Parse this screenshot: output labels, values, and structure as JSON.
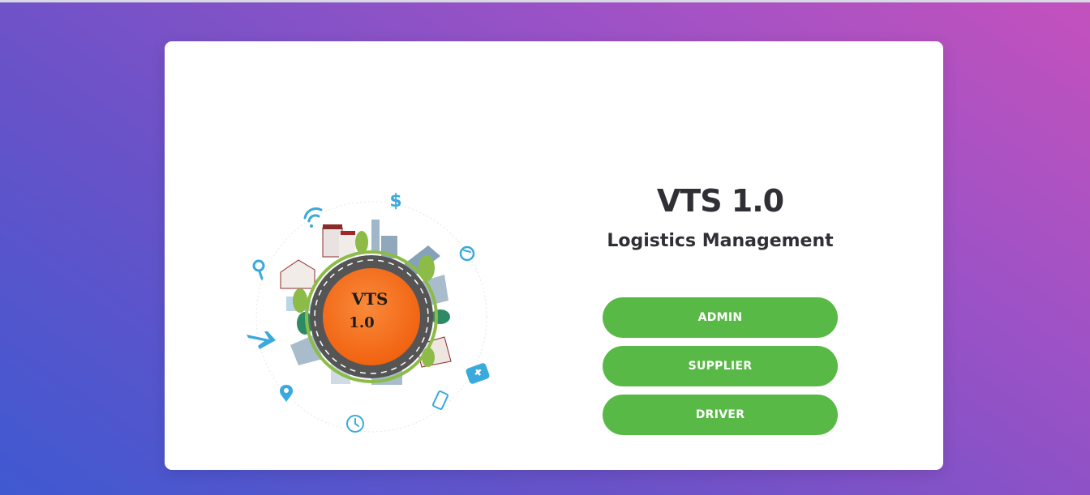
{
  "app": {
    "title": "VTS 1.0",
    "subtitle": "Logistics Management"
  },
  "illustration": {
    "badge_line1": "VTS",
    "badge_line2": "1.0",
    "icons": [
      "wifi-icon",
      "dollar-icon",
      "recycle-icon",
      "search-icon",
      "airplane-icon",
      "location-pin-icon",
      "clock-icon",
      "phone-icon",
      "first-aid-kit-icon"
    ]
  },
  "roles": {
    "admin_label": "ADMIN",
    "supplier_label": "SUPPLIER",
    "driver_label": "DRIVER"
  },
  "colors": {
    "button": "#59b947",
    "badge": "#f26a1b",
    "road": "#4a4a4a",
    "icon": "#3aa9dd"
  }
}
